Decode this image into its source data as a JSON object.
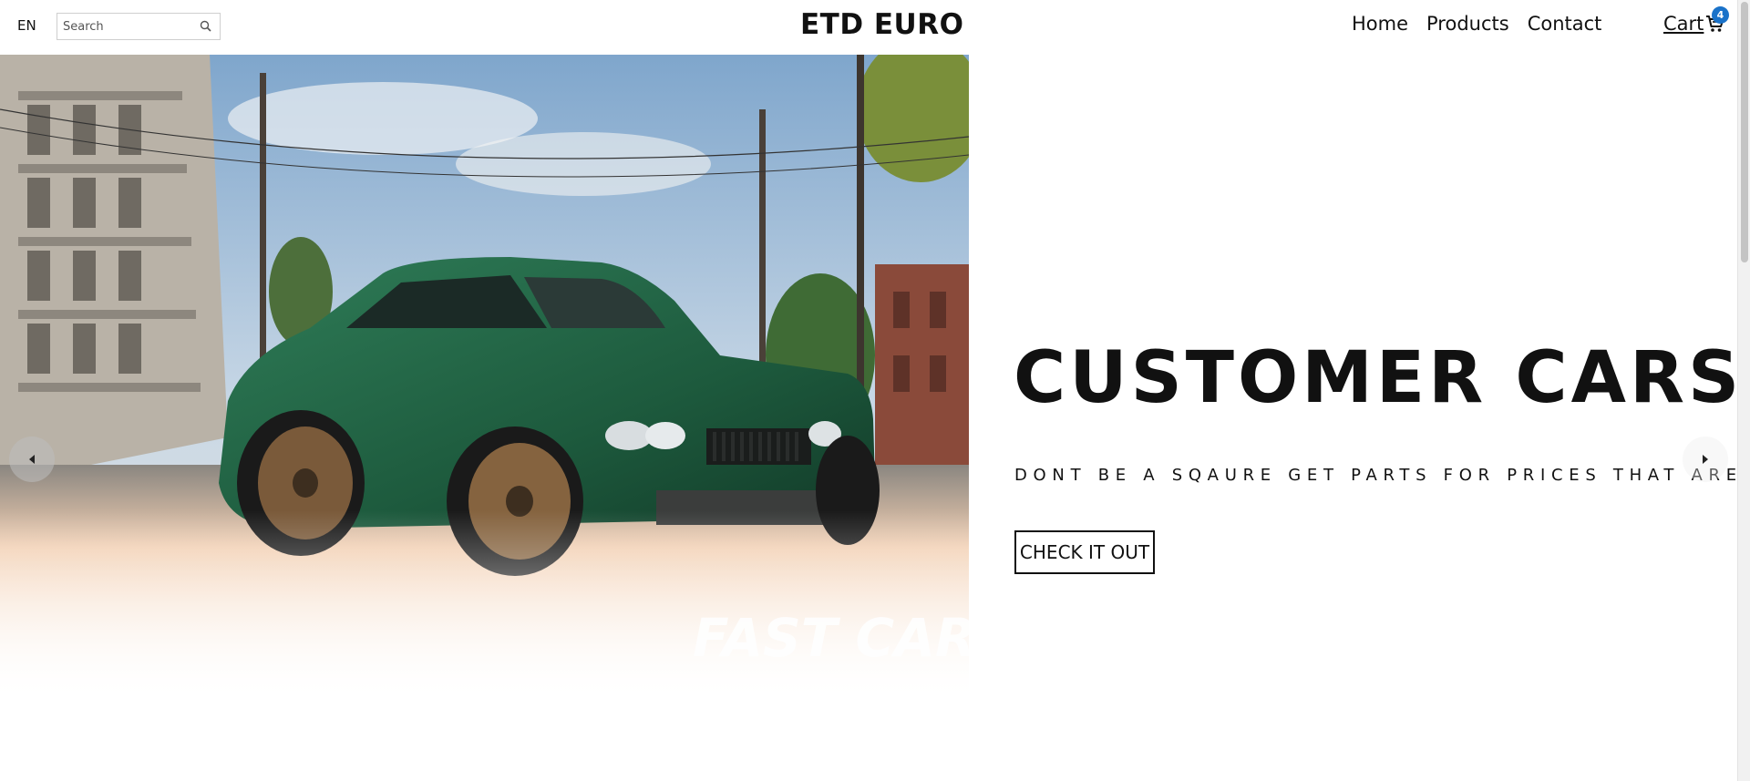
{
  "header": {
    "language": "EN",
    "search_placeholder": "Search",
    "logo": "ETD EURO",
    "nav": [
      "Home",
      "Products",
      "Contact"
    ],
    "cart_label": "Cart",
    "cart_count": "4"
  },
  "hero": {
    "title": "CUSTOMER CARS",
    "subtitle": "DONT BE A SQAURE GET PARTS FOR PRICES THAT ARE FAIR",
    "cta_label": "CHECK IT OUT",
    "image_watermark": "FAST CAR"
  },
  "icons": {
    "search": "search-icon",
    "cart": "cart-icon",
    "prev": "caret-left-icon",
    "next": "caret-right-icon"
  },
  "colors": {
    "badge": "#1a72c9",
    "car": "#1f5a3e",
    "sky": "#8fb4d6"
  }
}
